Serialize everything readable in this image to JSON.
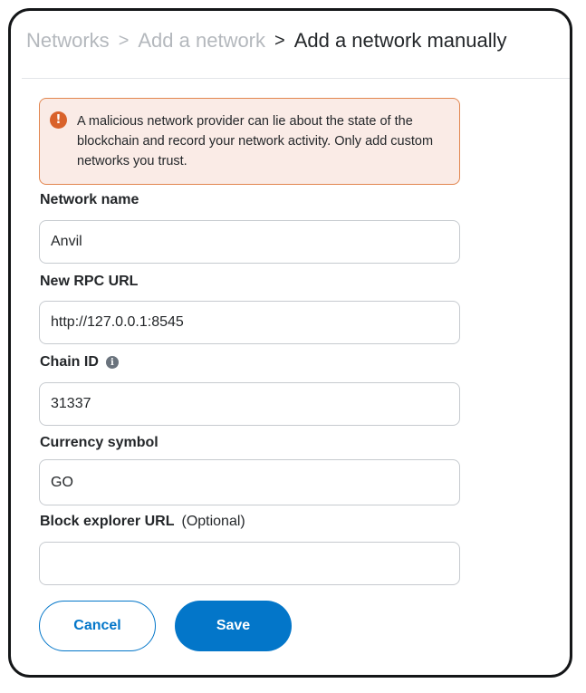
{
  "breadcrumb": {
    "items": [
      "Networks",
      "Add a network",
      "Add a network manually"
    ],
    "separator": ">"
  },
  "warning": {
    "icon": "exclamation-icon",
    "text": "A malicious network provider can lie about the state of the blockchain and record your network activity. Only add custom networks you trust."
  },
  "fields": {
    "network_name": {
      "label": "Network name",
      "value": "Anvil"
    },
    "rpc_url": {
      "label": "New RPC URL",
      "value": "http://127.0.0.1:8545"
    },
    "chain_id": {
      "label": "Chain ID",
      "value": "31337",
      "info_icon": "i"
    },
    "currency_symbol": {
      "label": "Currency symbol",
      "value": "GO"
    },
    "block_explorer": {
      "label": "Block explorer URL",
      "optional": "(Optional)",
      "value": ""
    }
  },
  "buttons": {
    "cancel": "Cancel",
    "save": "Save"
  },
  "colors": {
    "primary": "#0376c9",
    "warning_bg": "#faebe6",
    "warning_border": "#e2864f",
    "warning_icon": "#d9622b"
  }
}
